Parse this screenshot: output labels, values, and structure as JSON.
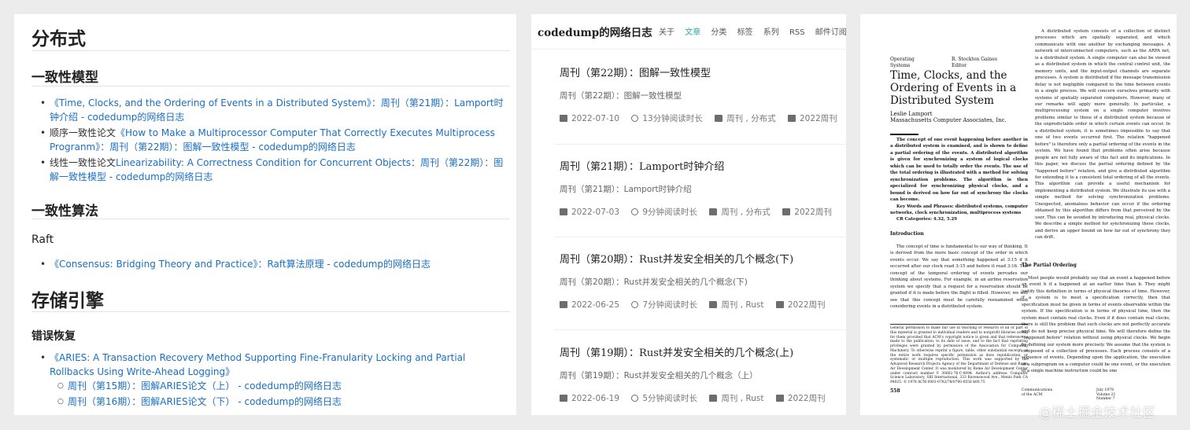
{
  "left": {
    "h1_dist": "分布式",
    "h2_consistency": "一致性模型",
    "consistency_items": [
      {
        "link": "《Time, Clocks, and the Ordering of Events in a Distributed System》：周刊（第21期）：Lamport时钟介绍 - codedump的网络日志",
        "pre": "",
        "post": ""
      },
      {
        "pre": "顺序一致性论文",
        "link": "《How to Make a Multiprocessor Computer That Correctly Executes Multiprocess Progranm》：周刊（第22期）：图解一致性模型 - codedump的网络日志"
      },
      {
        "pre": "线性一致性论文",
        "link": "Linearizability: A Correctness Condition for Concurrent Objects：周刊（第22期）：图解一致性模型 - codedump的网络日志"
      }
    ],
    "h2_algorithms": "一致性算法",
    "raft": "Raft",
    "raft_item": "《Consensus: Bridging Theory and Practice》：Raft算法原理 - codedump的网络日志",
    "h1_storage": "存储引擎",
    "h3_recovery": "错误恢复",
    "aries_item": "《ARIES: A Transaction Recovery Method Supporting Fine-Franularity Locking and Partial Rollbacks Using Write-Ahead Logging》",
    "aries_sub": [
      "周刊（第15期）：图解ARIES论文（上） - codedump的网络日志",
      "周刊（第16期）：图解ARIES论文（下） - codedump的网络日志"
    ]
  },
  "blog": {
    "brand": "codedump的网络日志",
    "nav": [
      "关于",
      "文章",
      "分类",
      "标签",
      "系列",
      "RSS",
      "邮件订阅"
    ],
    "active_nav": "文章",
    "posts": [
      {
        "title": "周刊（第22期）：图解一致性模型",
        "desc": "周刊（第22期）：图解一致性模型",
        "date": "2022-07-10",
        "read": "13分钟阅读时长",
        "cats": "周刊 , 分布式",
        "series": "2022周刊"
      },
      {
        "title": "周刊（第21期）：Lamport时钟介绍",
        "desc": "周刊（第21期）：Lamport时钟介绍",
        "date": "2022-07-03",
        "read": "9分钟阅读时长",
        "cats": "周刊 , 分布式",
        "series": "2022周刊"
      },
      {
        "title": "周刊（第20期）：Rust并发安全相关的几个概念(下)",
        "desc": "周刊（第20期）：Rust并发安全相关的几个概念(下)",
        "date": "2022-06-25",
        "read": "7分钟阅读时长",
        "cats": "周刊 , Rust",
        "series": "2022周刊"
      },
      {
        "title": "周刊（第19期）：Rust并发安全相关的几个概念(上)",
        "desc": "周刊（第19期）：Rust并发安全相关的几个概念（上）",
        "date": "2022-06-19",
        "read": "5分钟阅读时长",
        "cats": "周刊 , Rust",
        "series": "2022周刊"
      }
    ],
    "accent_color": "#2ba5a0"
  },
  "paper": {
    "dept": "Operating\nSystems",
    "editor": "R. Stockton Gaines\nEditor",
    "title": "Time, Clocks, and the Ordering of Events in a Distributed System",
    "author": "Leslie Lamport",
    "affiliation": "Massachusetts Computer Associates, Inc.",
    "abstract": "The concept of one event happening before another in a distributed system is examined, and is shown to define a partial ordering of the events. A distributed algorithm is given for synchronizing a system of logical clocks which can be used to totally order the events. The use of the total ordering is illustrated with a method for solving synchronization problems. The algorithm is then specialized for synchronizing physical clocks, and a bound is derived on how far out of synchrony the clocks can become.",
    "keywords": "Key Words and Phrases: distributed systems, computer networks, clock synchronization, multiprocess systems",
    "cr": "CR Categories: 4.32, 5.29",
    "intro_heading": "Introduction",
    "intro": "The concept of time is fundamental to our way of thinking. It is derived from the more basic concept of the order in which events occur. We say that something happened at 3:15 if it occurred after our clock read 3:15 and before it read 3:16. The concept of the temporal ordering of events pervades our thinking about systems. For example, in an airline reservation system we specify that a request for a reservation should be granted if it is made before the flight is filled. However, we will see that this concept must be carefully reexamined when considering events in a distributed system.",
    "footnote": "General permission to make fair use in teaching or research of all or part of this material is granted to individual readers and to nonprofit libraries acting for them provided that ACM's copyright notice is given and that reference is made to the publication, to its date of issue, and to the fact that reprinting privileges were granted by permission of the Association for Computing Machinery. To otherwise reprint a figure, table, other substantial excerpt, or the entire work requires specific permission as does republication, or systematic or multiple reproduction. This work was supported by the Advanced Research Projects Agency of the Department of Defense and Rome Air Development Center. It was monitored by Rome Air Development Center under contract number F 30602-76-C-0094. Author's address: Computer Science Laboratory, SRI International, 333 Ravenswood Ave., Menlo Park CA 94025. © 1978 ACM 0001-0782/78/0700-0558 $00.75",
    "page_no": "558",
    "right_col_1": "A distributed system consists of a collection of distinct processes which are spatially separated, and which communicate with one another by exchanging messages. A network of interconnected computers, such as the ARPA net, is a distributed system. A single computer can also be viewed as a distributed system in which the central control unit, the memory units, and the input-output channels are separate processes. A system is distributed if the message transmission delay is not negligible compared to the time between events in a single process. We will concern ourselves primarily with systems of spatially separated computers. However, many of our remarks will apply more generally. In particular, a multiprocessing system on a single computer involves problems similar to those of a distributed system because of the unpredictable order in which certain events can occur. In a distributed system, it is sometimes impossible to say that one of two events occurred first. The relation \"happened before\" is therefore only a partial ordering of the events in the system. We have found that problems often arise because people are not fully aware of this fact and its implications. In this paper, we discuss the partial ordering defined by the \"happened before\" relation, and give a distributed algorithm for extending it to a consistent total ordering of all the events. This algorithm can provide a useful mechanism for implementing a distributed system. We illustrate its use with a simple method for solving synchronization problems. Unexpected, anomalous behavior can occur if the ordering obtained by this algorithm differs from that perceived by the user. This can be avoided by introducing real, physical clocks. We describe a simple method for synchronizing these clocks, and derive an upper bound on how far out of synchrony they can drift.",
    "partial_heading": "The Partial Ordering",
    "right_col_2": "Most people would probably say that an event a happened before an event b if a happened at an earlier time than b. They might justify this definition in terms of physical theories of time. However, if a system is to meet a specification correctly, then that specification must be given in terms of events observable within the system. If the specification is in terms of physical time, then the system must contain real clocks. Even if it does contain real clocks, there is still the problem that such clocks are not perfectly accurate and do not keep precise physical time. We will therefore define the \"happened before\" relation without using physical clocks. We begin by defining our system more precisely. We assume that the system is composed of a collection of processes. Each process consists of a sequence of events. Depending upon the application, the execution of a subprogram on a computer could be one event, or the execution of a single machine instruction could be one",
    "footer": "Communications of the ACM",
    "footer_right": "July 1978 Volume 21 Number 7"
  },
  "watermark": "@稀土掘金技术社区"
}
